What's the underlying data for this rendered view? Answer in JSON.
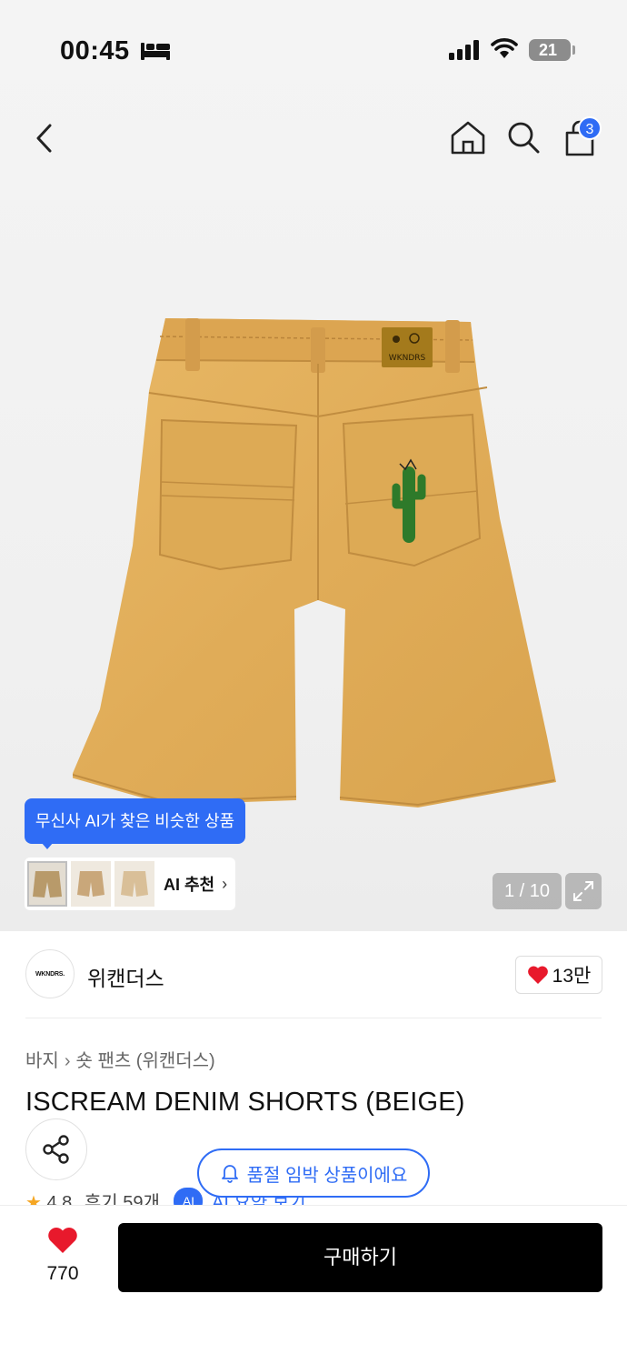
{
  "status_bar": {
    "time": "00:45",
    "battery": "21"
  },
  "nav": {
    "cart_count": "3"
  },
  "gallery": {
    "ai_tooltip": "무신사 AI가 찾은 비슷한 상품",
    "ai_recommend_label": "AI 추천",
    "pager": "1 / 10"
  },
  "brand": {
    "logo_text": "WKNDRS.",
    "name": "위캔더스",
    "likes": "13만"
  },
  "breadcrumb": {
    "category": "바지",
    "subcategory": "숏 팬츠 (위캔더스)"
  },
  "product": {
    "title": "ISCREAM DENIM SHORTS (BEIGE)",
    "patch_text": "WKNDRS"
  },
  "notice": {
    "soldout_text": "품절 임박 상품이에요"
  },
  "rating": {
    "score": "4.8",
    "reviews": "후기 59개",
    "ai_chip": "AI",
    "ai_summary": "AI 요약 보기"
  },
  "bottom_bar": {
    "wish_count": "770",
    "buy_label": "구매하기"
  },
  "colors": {
    "accent": "#2f6cf5",
    "heart": "#e8192c",
    "buy_bg": "#000000",
    "denim": "#e2b05c"
  }
}
